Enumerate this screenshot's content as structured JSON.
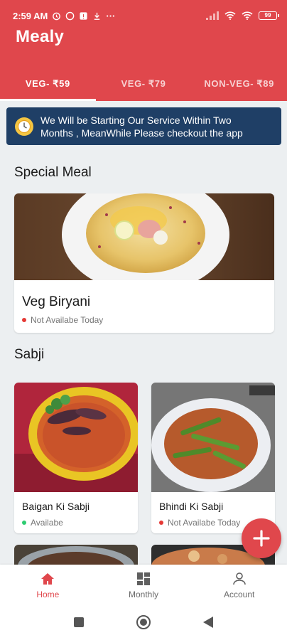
{
  "status_bar": {
    "time": "2:59 AM",
    "battery": "99"
  },
  "app": {
    "title": "Mealy"
  },
  "tabs": [
    {
      "label": "VEG- ₹59",
      "active": true
    },
    {
      "label": "VEG- ₹79",
      "active": false
    },
    {
      "label": "NON-VEG- ₹89",
      "active": false
    }
  ],
  "notice": {
    "line1": "We Will be Starting Our Service Within Two",
    "line2": "Months , MeanWhile Please checkout the app"
  },
  "special_meal": {
    "heading": "Special Meal",
    "item": {
      "name": "Veg Biryani",
      "availability": "Not Availabe Today",
      "status_color": "#e53935"
    }
  },
  "sabji": {
    "heading": "Sabji",
    "items": [
      {
        "name": "Baigan Ki Sabji",
        "availability": "Availabe",
        "status_color": "#2ecc71"
      },
      {
        "name": "Bhindi Ki Sabji",
        "availability": "Not Availabe Today",
        "status_color": "#e53935"
      }
    ]
  },
  "fab": {
    "icon": "plus-icon"
  },
  "bottom_nav": [
    {
      "label": "Home",
      "icon": "home-icon",
      "active": true
    },
    {
      "label": "Monthly",
      "icon": "grid-icon",
      "active": false
    },
    {
      "label": "Account",
      "icon": "person-icon",
      "active": false
    }
  ],
  "colors": {
    "primary": "#e0474c",
    "notice_bg": "#1f3f66"
  }
}
